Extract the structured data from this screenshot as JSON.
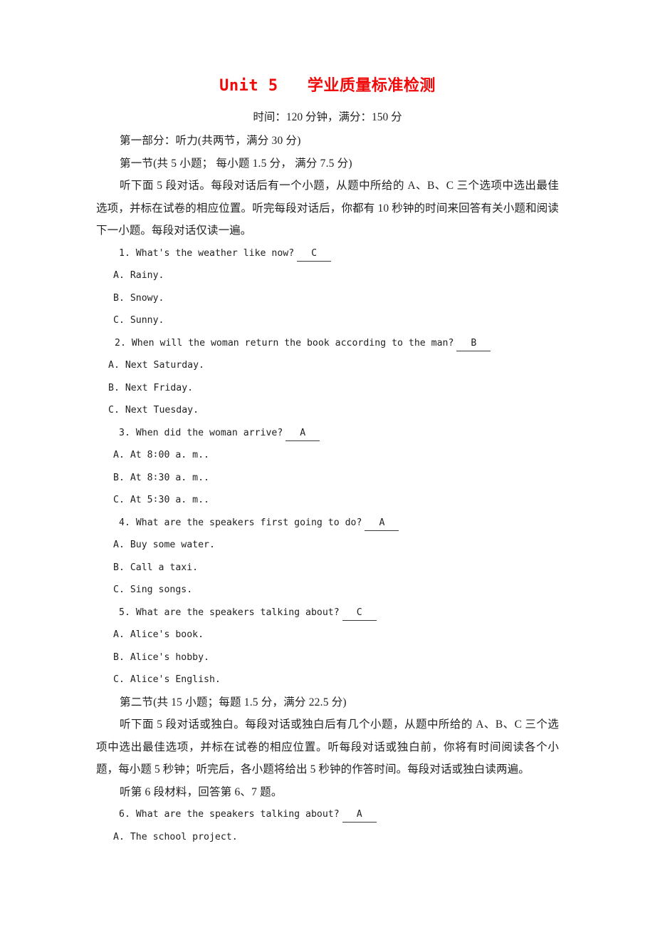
{
  "title": "Unit 5   学业质量标准检测",
  "subtitle": "时间：120 分钟，满分：150 分",
  "part1": {
    "heading": "第一部分：听力(共两节，满分 30 分)",
    "section1_heading": "第一节(共 5 小题；  每小题 1.5 分，  满分 7.5 分)",
    "section1_instructions": "听下面 5 段对话。每段对话后有一个小题，从题中所给的 A、B、C 三个选项中选出最佳选项，并标在试卷的相应位置。听完每段对话后，你都有 10 秒钟的时间来回答有关小题和阅读下一小题。每段对话仅读一遍。",
    "section2_heading": "第二节(共 15 小题；每题 1.5 分，满分 22.5 分)",
    "section2_instructions": "听下面 5 段对话或独白。每段对话或独白后有几个小题，从题中所给的 A、B、C 三个选项中选出最佳选项，并标在试卷的相应位置。听每段对话或独白前，你将有时间阅读各个小题，每小题 5 秒钟；听完后，各小题将给出 5 秒钟的作答时间。每段对话或独白读两遍。",
    "material6_note": "听第 6 段材料，回答第 6、7 题。"
  },
  "questions": [
    {
      "number": "1.",
      "text": "What's the weather like now?",
      "answer": "C",
      "options": [
        "A. Rainy.",
        "B. Snowy.",
        "C. Sunny."
      ]
    },
    {
      "number": "2.",
      "text": "When will the woman return the book according to the man?",
      "answer": "B",
      "options": [
        "A. Next Saturday.",
        "B. Next Friday.",
        "C. Next Tuesday."
      ]
    },
    {
      "number": "3.",
      "text": "When did the woman arrive?",
      "answer": "A",
      "options": [
        "A. At 8∶00 a. m..",
        "B. At 8∶30 a. m..",
        "C. At 5∶30 a. m.."
      ]
    },
    {
      "number": "4.",
      "text": "What are the speakers first going to do?",
      "answer": "A",
      "options": [
        "A. Buy some water.",
        "B. Call a taxi.",
        "C. Sing songs."
      ]
    },
    {
      "number": "5.",
      "text": "What are the speakers talking about?",
      "answer": "C",
      "options": [
        "A. Alice's book.",
        "B. Alice's hobby.",
        "C. Alice's English."
      ]
    },
    {
      "number": "6.",
      "text": "What are the speakers talking about?",
      "answer": "A",
      "options": [
        "A. The school project."
      ]
    }
  ],
  "colors": {
    "title_red": "#f00a0a",
    "body_text": "#1f1f1f",
    "page_background": "#ffffff"
  }
}
